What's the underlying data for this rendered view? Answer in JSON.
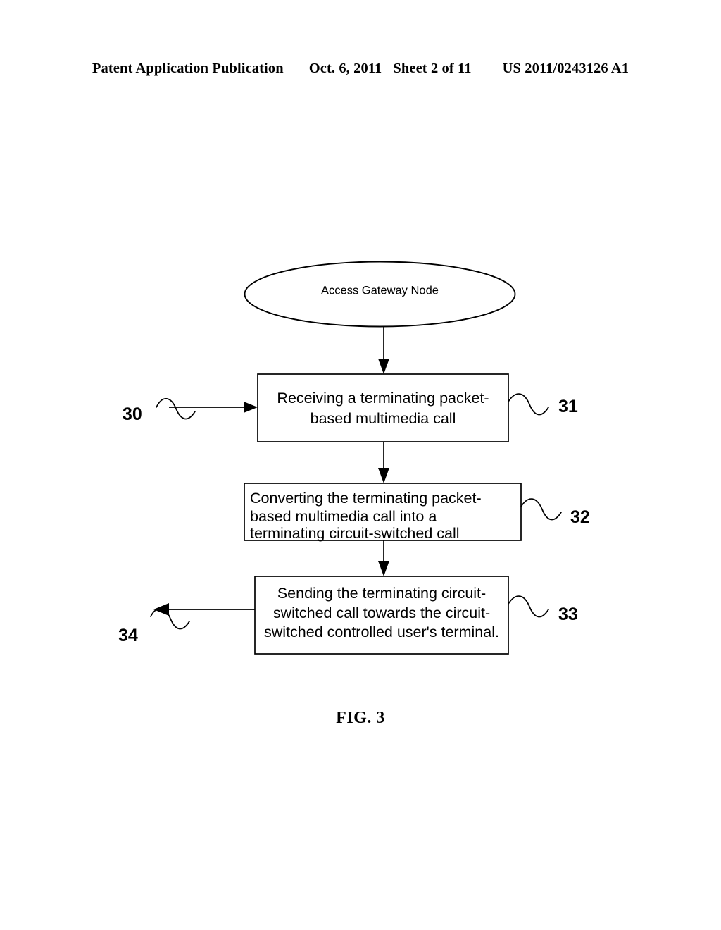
{
  "header": {
    "publication": "Patent Application Publication",
    "date": "Oct. 6, 2011",
    "sheet": "Sheet 2 of 11",
    "patent_number": "US 2011/0243126 A1"
  },
  "figure": {
    "caption": "FIG. 3",
    "start_node": {
      "ref": "",
      "label": "Access Gateway Node",
      "shape": "ellipse"
    },
    "steps": [
      {
        "ref": "31",
        "shape": "rect",
        "align": "center",
        "lines": [
          "Receiving a terminating packet-",
          "based multimedia call"
        ]
      },
      {
        "ref": "32",
        "shape": "rect",
        "align": "left",
        "lines": [
          "Converting the terminating packet-",
          "based multimedia call into a",
          "terminating circuit-switched call"
        ]
      },
      {
        "ref": "33",
        "shape": "rect",
        "align": "center",
        "lines": [
          "Sending the terminating circuit-",
          "switched call towards the circuit-",
          "switched controlled user's terminal."
        ]
      }
    ],
    "flow_refs": {
      "input": "30",
      "output": "34"
    }
  },
  "colors": {
    "ink": "#000000",
    "paper": "#ffffff"
  }
}
